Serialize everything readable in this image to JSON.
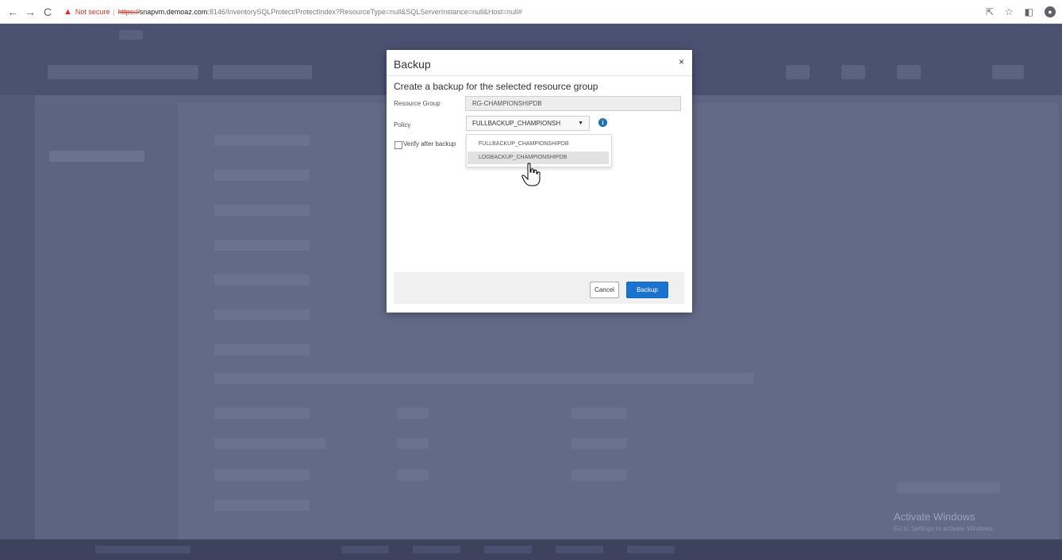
{
  "browser": {
    "back": "←",
    "forward": "→",
    "reload": "C",
    "warning_icon": "▲",
    "security_label": "Not secure",
    "separator": "|",
    "url_scheme": "https://",
    "url_host": "snapvm.demoaz.com",
    "url_path": ":8146/InventorySQLProtect/ProtectIndex?ResourceType=null&SQLServerInstance=null&Host=null#",
    "icons": [
      "share-icon",
      "star-icon",
      "sidebar-icon",
      "profile-icon"
    ],
    "share_glyph": "⇱",
    "star_glyph": "☆",
    "sidebar_glyph": "◧",
    "profile_glyph": "●"
  },
  "modal": {
    "title": "Backup",
    "close": "×",
    "subtitle": "Create a backup for the selected resource group",
    "resource_group_label": "Resource Group",
    "resource_group_value": "RG-CHAMPIONSHIPDB",
    "policy_label": "Policy",
    "policy_selected": "FULLBACKUP_CHAMPIONSH",
    "policy_caret": "▼",
    "info_glyph": "i",
    "policy_options": [
      "FULLBACKUP_CHAMPIONSHIPDB",
      "LOGBACKUP_CHAMPIONSHIPDB"
    ],
    "highlighted_option": "LOGBACKUP_CHAMPIONSHIPDB",
    "verify_label": "Verify after backup",
    "verify_checked": false,
    "cancel_label": "Cancel",
    "backup_label": "Backup"
  },
  "watermark": {
    "title": "Activate Windows",
    "subtitle": "Go to Settings to activate Windows."
  },
  "colors": {
    "primary_button": "#1a73d0",
    "overlay": "#5e6582",
    "info_icon": "#1f6fb2",
    "warning": "#d93025"
  }
}
